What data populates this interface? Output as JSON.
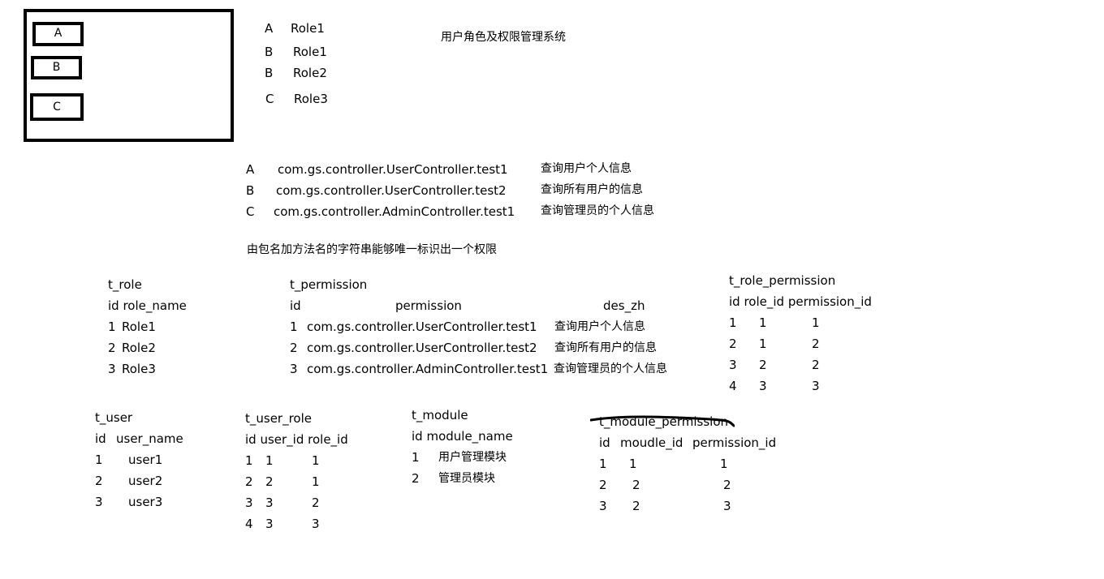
{
  "title": "用户角色及权限管理系统",
  "boxes": [
    "A",
    "B",
    "C"
  ],
  "user_roles_preview": [
    {
      "user": "A",
      "role": "Role1"
    },
    {
      "user": "B",
      "role": "Role1"
    },
    {
      "user": "B",
      "role": "Role2"
    },
    {
      "user": "C",
      "role": "Role3"
    }
  ],
  "permission_preview": [
    {
      "key": "A",
      "method": "com.gs.controller.UserController.test1",
      "desc": "查询用户个人信息"
    },
    {
      "key": "B",
      "method": "com.gs.controller.UserController.test2",
      "desc": "查询所有用户的信息"
    },
    {
      "key": "C",
      "method": "com.gs.controller.AdminController.test1",
      "desc": "查询管理员的个人信息"
    }
  ],
  "note": "由包名加方法名的字符串能够唯一标识出一个权限",
  "t_role": {
    "name": "t_role",
    "header": "id role_name",
    "rows": [
      {
        "id": "1",
        "name": "Role1"
      },
      {
        "id": "2",
        "name": "Role2"
      },
      {
        "id": "3",
        "name": "Role3"
      }
    ]
  },
  "t_permission": {
    "name": "t_permission",
    "headers": [
      "id",
      "permission",
      "des_zh"
    ],
    "rows": [
      {
        "id": "1",
        "permission": "com.gs.controller.UserController.test1",
        "des": "查询用户个人信息"
      },
      {
        "id": "2",
        "permission": "com.gs.controller.UserController.test2",
        "des": "查询所有用户的信息"
      },
      {
        "id": "3",
        "permission": "com.gs.controller.AdminController.test1",
        "des": "查询管理员的个人信息"
      }
    ]
  },
  "t_role_permission": {
    "name": "t_role_permission",
    "header": "id role_id permission_id",
    "rows": [
      {
        "id": "1",
        "role_id": "1",
        "permission_id": "1"
      },
      {
        "id": "2",
        "role_id": "1",
        "permission_id": "2"
      },
      {
        "id": "3",
        "role_id": "2",
        "permission_id": "2"
      },
      {
        "id": "4",
        "role_id": "3",
        "permission_id": "3"
      }
    ]
  },
  "t_user": {
    "name": "t_user",
    "headers": [
      "id",
      "user_name"
    ],
    "rows": [
      {
        "id": "1",
        "name": "user1"
      },
      {
        "id": "2",
        "name": "user2"
      },
      {
        "id": "3",
        "name": "user3"
      }
    ]
  },
  "t_user_role": {
    "name": "t_user_role",
    "header": "id user_id role_id",
    "rows": [
      {
        "id": "1",
        "user_id": "1",
        "role_id": "1"
      },
      {
        "id": "2",
        "user_id": "2",
        "role_id": "1"
      },
      {
        "id": "3",
        "user_id": "3",
        "role_id": "2"
      },
      {
        "id": "4",
        "user_id": "3",
        "role_id": "3"
      }
    ]
  },
  "t_module": {
    "name": "t_module",
    "header": "id module_name",
    "rows": [
      {
        "id": "1",
        "name": "用户管理模块"
      },
      {
        "id": "2",
        "name": "管理员模块"
      }
    ]
  },
  "t_module_permission": {
    "name": "t_module_permission",
    "headers": [
      "id",
      "moudle_id",
      "permission_id"
    ],
    "rows": [
      {
        "id": "1",
        "module_id": "1",
        "permission_id": "1"
      },
      {
        "id": "2",
        "module_id": "2",
        "permission_id": "2"
      },
      {
        "id": "3",
        "module_id": "2",
        "permission_id": "3"
      }
    ]
  }
}
